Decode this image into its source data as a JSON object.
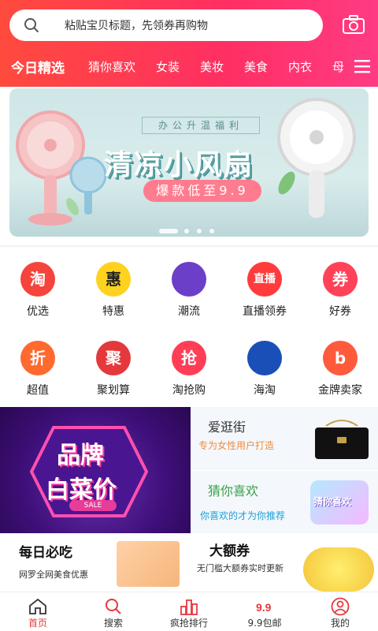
{
  "search": {
    "placeholder": "粘贴宝贝标题，先领券再购物"
  },
  "tabs": [
    "今日精选",
    "猜你喜欢",
    "女装",
    "美妆",
    "美食",
    "内衣",
    "母"
  ],
  "banner": {
    "subtitle": "办公升温福利",
    "title": "清凉小风扇",
    "price_tag": "爆款低至9.9",
    "slides_total": 4,
    "slide_active": 1
  },
  "grid": [
    {
      "label": "优选",
      "icon": "tao-icon",
      "glyph": "淘",
      "color": "#f5443b"
    },
    {
      "label": "特惠",
      "icon": "hui-icon",
      "glyph": "惠",
      "color": "#ffd21f"
    },
    {
      "label": "潮流",
      "icon": "trend-icon",
      "glyph": "",
      "color": "#6b3fc8"
    },
    {
      "label": "直播领券",
      "icon": "live-icon",
      "glyph": "直播",
      "color": "#ff3b3b"
    },
    {
      "label": "好券",
      "icon": "coupon-icon",
      "glyph": "券",
      "color": "#ff4258"
    },
    {
      "label": "超值",
      "icon": "discount-icon",
      "glyph": "折",
      "color": "#ff6a2e"
    },
    {
      "label": "聚划算",
      "icon": "juhuasuan-icon",
      "glyph": "聚",
      "color": "#e5383b"
    },
    {
      "label": "淘抢购",
      "icon": "rush-icon",
      "glyph": "抢",
      "color": "#ff3d57"
    },
    {
      "label": "海淘",
      "icon": "haitao-icon",
      "glyph": "",
      "color": "#1b4fb8"
    },
    {
      "label": "金牌卖家",
      "icon": "gold-seller-icon",
      "glyph": "b",
      "color": "#ff5a3c"
    }
  ],
  "promo": {
    "left_title_1": "品牌",
    "left_title_2": "白菜价",
    "left_badge": "SALE",
    "r1_title": "爱逛街",
    "r1_sub": "专为女性用户打造",
    "r2_title": "猜你喜欢",
    "r2_sub": "你喜欢的才为你推荐",
    "r2_tag": "猜你喜欢"
  },
  "strip": {
    "left_title": "每日必吃",
    "left_sub": "网罗全网美食优惠",
    "right_title": "大额券",
    "right_sub": "无门槛大额券实时更新"
  },
  "nav": [
    {
      "label": "首页",
      "icon": "home-icon",
      "active": true
    },
    {
      "label": "搜索",
      "icon": "search-icon",
      "active": false
    },
    {
      "label": "疯抢排行",
      "icon": "ranking-icon",
      "active": false
    },
    {
      "label": "9.9包邮",
      "icon": "nine-nine-icon",
      "active": false
    },
    {
      "label": "我的",
      "icon": "profile-icon",
      "active": false
    }
  ],
  "colors": {
    "header_start": "#ff4a3d",
    "header_end": "#ff3b84",
    "nav_active": "#e8383d"
  }
}
